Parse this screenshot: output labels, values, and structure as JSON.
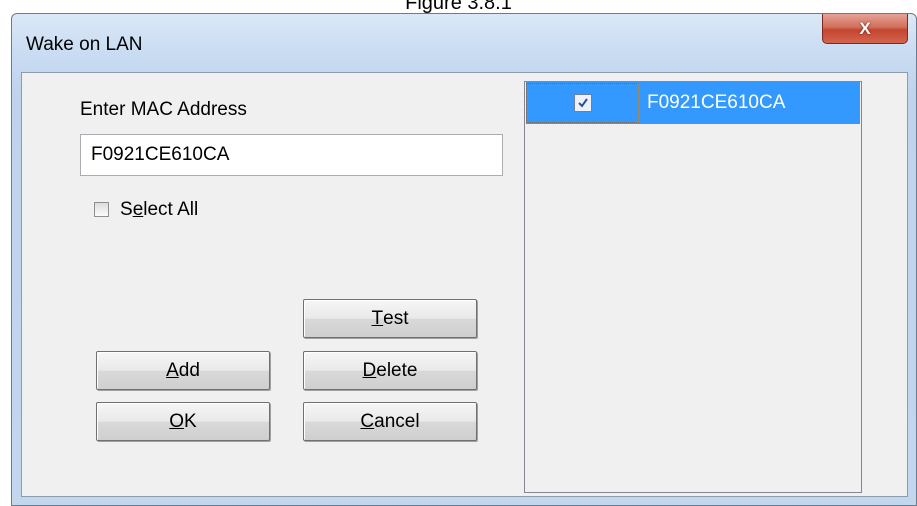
{
  "figure_caption": "Figure 3.8.1",
  "window": {
    "title": "Wake on LAN",
    "close_glyph": "X"
  },
  "form": {
    "mac_label": "Enter MAC Address",
    "mac_value": "F0921CE610CA",
    "select_all_prefix": "S",
    "select_all_mnemonic": "e",
    "select_all_suffix": "lect All",
    "select_all_checked": false
  },
  "buttons": {
    "test": {
      "mnemonic": "T",
      "rest": "est"
    },
    "add": {
      "mnemonic": "A",
      "rest": "dd"
    },
    "delete": {
      "mnemonic": "D",
      "rest": "elete"
    },
    "ok": {
      "mnemonic": "O",
      "rest": "K"
    },
    "cancel": {
      "mnemonic": "C",
      "rest": "ancel"
    }
  },
  "mac_list": {
    "items": [
      {
        "mac": "F0921CE610CA",
        "checked": true,
        "selected": true
      }
    ]
  },
  "colors": {
    "selection": "#3399ff",
    "close_button": "#c4452f"
  }
}
